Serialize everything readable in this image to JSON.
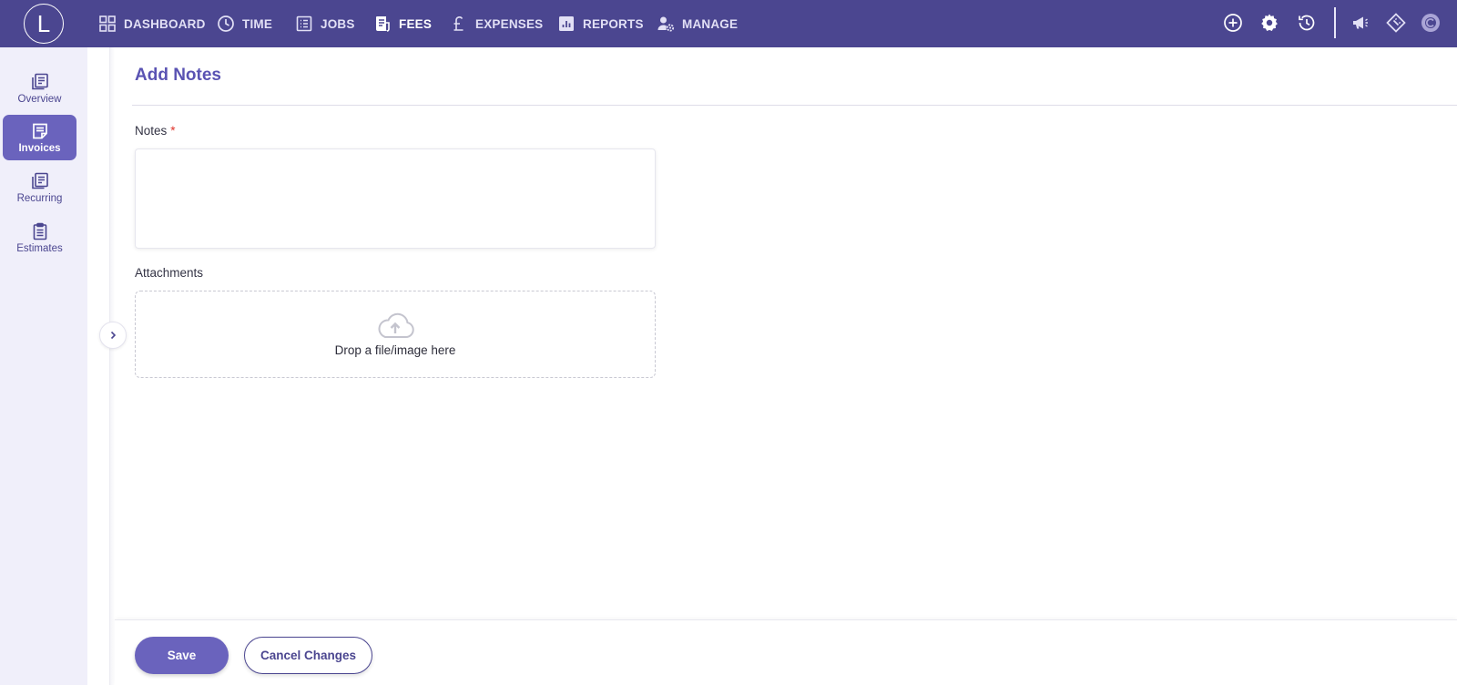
{
  "app": {
    "logo_letter": "L"
  },
  "topnav": {
    "items": [
      {
        "label": "DASHBOARD",
        "icon": "grid-icon",
        "active": false
      },
      {
        "label": "TIME",
        "icon": "clock-icon",
        "active": false
      },
      {
        "label": "JOBS",
        "icon": "list-icon",
        "active": false
      },
      {
        "label": "FEES",
        "icon": "receipt-icon",
        "active": true
      },
      {
        "label": "EXPENSES",
        "icon": "pound-icon",
        "active": false
      },
      {
        "label": "REPORTS",
        "icon": "report-icon",
        "active": false
      },
      {
        "label": "MANAGE",
        "icon": "user-gear-icon",
        "active": false
      }
    ],
    "right_icons": [
      "add-circle-icon",
      "gear-icon",
      "history-icon",
      "megaphone-icon",
      "ticket-icon",
      "c-logo-icon"
    ]
  },
  "sidebar": {
    "items": [
      {
        "label": "Overview",
        "icon": "overview-icon",
        "active": false
      },
      {
        "label": "Invoices",
        "icon": "invoice-icon",
        "active": true
      },
      {
        "label": "Recurring",
        "icon": "recurring-icon",
        "active": false
      },
      {
        "label": "Estimates",
        "icon": "clipboard-icon",
        "active": false
      }
    ]
  },
  "main": {
    "title": "Add Notes",
    "notes": {
      "label": "Notes",
      "required_mark": "*",
      "value": ""
    },
    "attachments": {
      "label": "Attachments",
      "dropzone_text": "Drop a file/image here"
    }
  },
  "footer": {
    "save_label": "Save",
    "cancel_label": "Cancel Changes"
  },
  "colors": {
    "header": "#4b4690",
    "accent": "#6a63bd",
    "sidebar_bg": "#f0effa",
    "title": "#5a53b3",
    "required": "#e0332b"
  }
}
